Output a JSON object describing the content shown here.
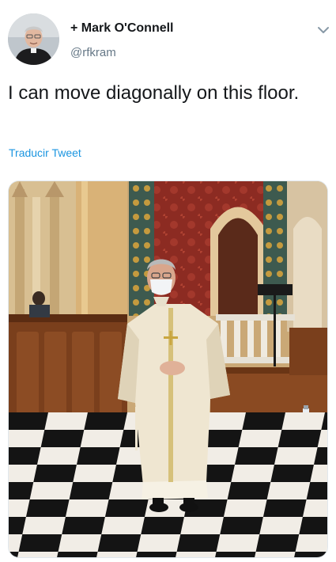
{
  "tweet": {
    "display_name": "+ Mark O'Connell",
    "handle": "@rfkram",
    "text": "I can move diagonally on this floor.",
    "translate_label": "Traducir Tweet"
  },
  "icons": {
    "more": "chevron-down-icon",
    "avatar": "avatar"
  },
  "colors": {
    "link": "#1b95e0",
    "secondary_text": "#657786",
    "primary_text": "#14171a"
  }
}
